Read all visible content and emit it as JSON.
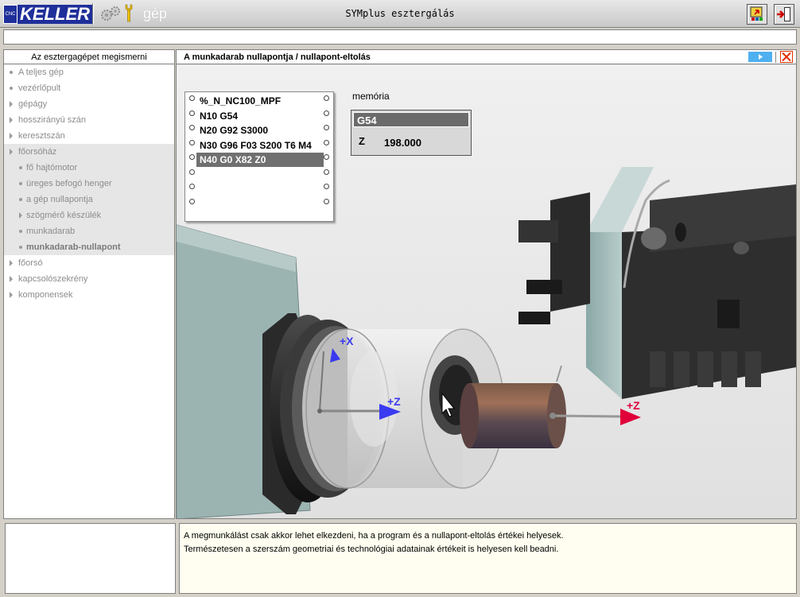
{
  "app": {
    "logo_cnc": "CNC",
    "logo_text": "KELLER",
    "mode_label": "gép",
    "title": "SYMplus esztergálás"
  },
  "nav": {
    "header": "Az esztergagépet megismerni",
    "items": [
      {
        "label": "A teljes gép",
        "marker": "bullet",
        "level": 0
      },
      {
        "label": "vezérlőpult",
        "marker": "bullet",
        "level": 0
      },
      {
        "label": "gépágy",
        "marker": "triangle",
        "level": 0
      },
      {
        "label": "hosszirányú szán",
        "marker": "triangle",
        "level": 0
      },
      {
        "label": "keresztszán",
        "marker": "triangle",
        "level": 0
      },
      {
        "label": "főorsóház",
        "marker": "triangle",
        "level": 0,
        "highlighted": true
      },
      {
        "label": "fő hajtómotor",
        "marker": "bullet",
        "level": 1,
        "highlighted": true
      },
      {
        "label": "üreges befogó henger",
        "marker": "bullet",
        "level": 1,
        "highlighted": true
      },
      {
        "label": "a gép nullapontja",
        "marker": "bullet",
        "level": 1,
        "highlighted": true
      },
      {
        "label": "szögmérő készülék",
        "marker": "triangle",
        "level": 1,
        "highlighted": true
      },
      {
        "label": "munkadarab",
        "marker": "bullet",
        "level": 1,
        "highlighted": true
      },
      {
        "label": "munkadarab-nullapont",
        "marker": "bullet",
        "level": 1,
        "highlighted": true,
        "active": true
      },
      {
        "label": "főorsó",
        "marker": "triangle",
        "level": 0
      },
      {
        "label": "kapcsolószekrény",
        "marker": "triangle",
        "level": 0
      },
      {
        "label": "komponensek",
        "marker": "triangle",
        "level": 0
      }
    ]
  },
  "main": {
    "title": "A munkadarab nullapontja / nullapont-eltolás",
    "program": {
      "lines": [
        "%_N_NC100_MPF",
        "N10 G54",
        "N20 G92 S3000",
        "N30 G96 F03 S200 T6 M4",
        "N40 G0 X82 Z0"
      ],
      "selected_index": 4
    },
    "memory": {
      "label": "memória",
      "offset": "G54",
      "axis": "Z",
      "value": "198.000"
    },
    "axis_labels": {
      "x_plus": "+X",
      "z_plus_left": "+Z",
      "z_plus_right": "+Z"
    }
  },
  "description": {
    "line1": "A megmunkálást csak akkor lehet elkezdeni, ha a program és a nullapont-eltolás értékei helyesek.",
    "line2": "Természetesen a szerszám geometriai és technológiai adatainak értékeit is helyesen kell beadni."
  },
  "colors": {
    "logo_blue": "#1f2f9a",
    "play_blue": "#4fb0f0",
    "close_red": "#e03000",
    "axis_blue": "#3a3af0",
    "axis_red": "#e0003a"
  }
}
